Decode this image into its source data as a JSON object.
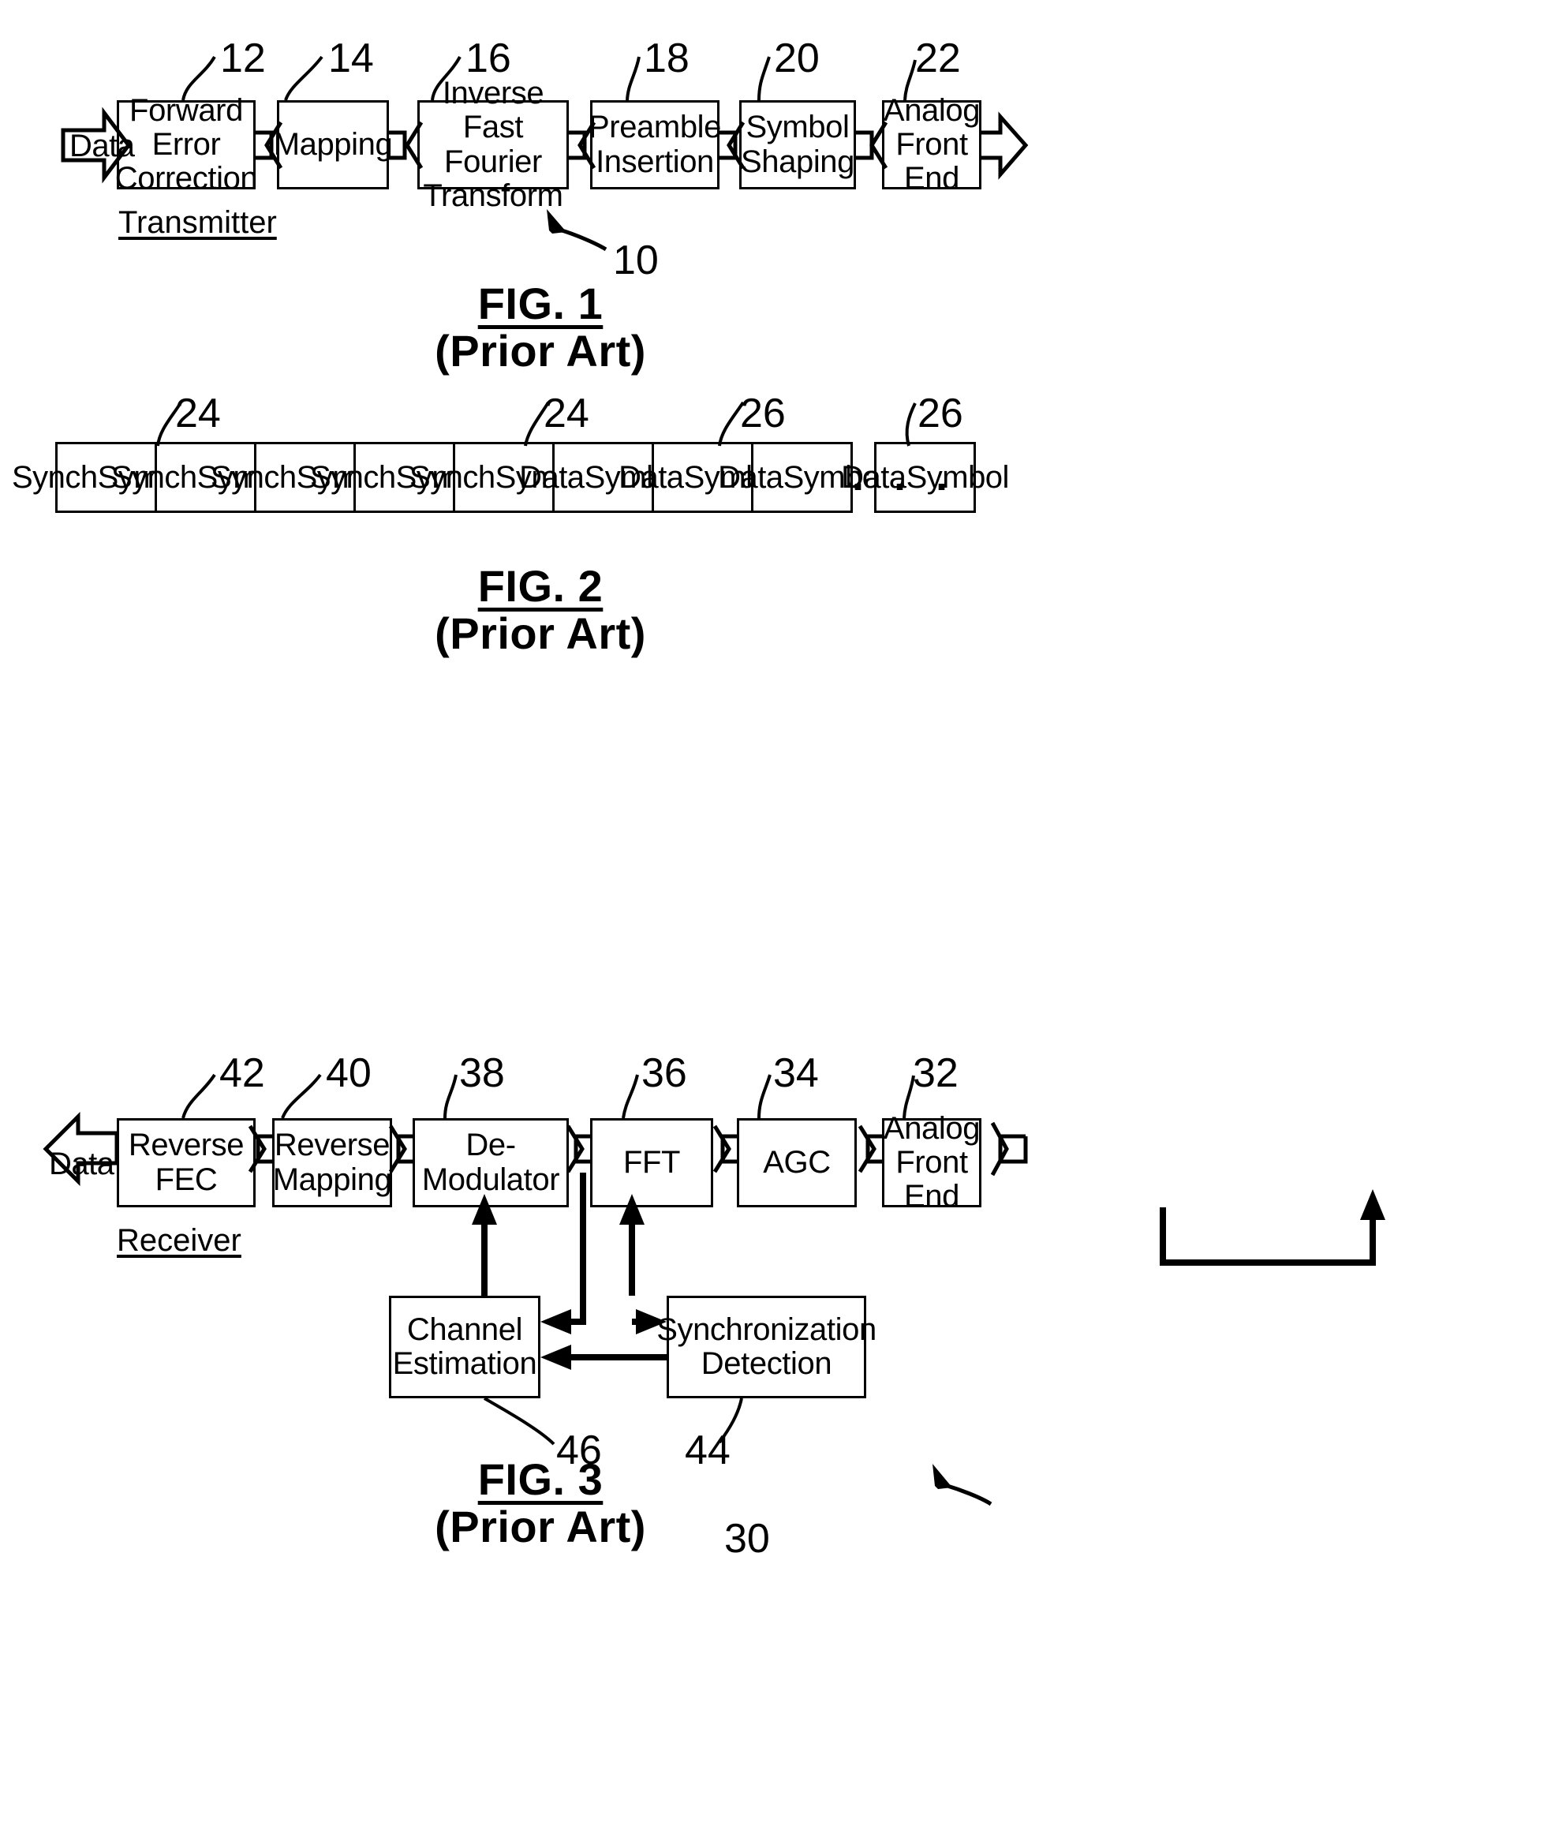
{
  "document": {
    "type": "patent-drawing-sheet",
    "figures": [
      {
        "id": "fig1",
        "caption": "FIG. 1",
        "subcaption": "(Prior Art)",
        "group_label": "Transmitter",
        "system_ref": "10",
        "io": {
          "input_label": "Data"
        },
        "blocks": [
          {
            "ref": "12",
            "lines": [
              "Forward",
              "Error",
              "Correction"
            ]
          },
          {
            "ref": "14",
            "lines": [
              "Mapping"
            ]
          },
          {
            "ref": "16",
            "lines": [
              "Inverse",
              "Fast Fourier",
              "Transform"
            ]
          },
          {
            "ref": "18",
            "lines": [
              "Preamble",
              "Insertion"
            ]
          },
          {
            "ref": "20",
            "lines": [
              "Symbol",
              "Shaping"
            ]
          },
          {
            "ref": "22",
            "lines": [
              "Analog",
              "Front",
              "End"
            ]
          }
        ]
      },
      {
        "id": "fig2",
        "caption": "FIG. 2",
        "subcaption": "(Prior Art)",
        "ellipsis": "· · ·",
        "callouts": [
          {
            "ref": "24"
          },
          {
            "ref": "24"
          },
          {
            "ref": "26"
          },
          {
            "ref": "26"
          }
        ],
        "cells": [
          {
            "lines": [
              "Synch",
              "Symbol"
            ]
          },
          {
            "lines": [
              "Synch",
              "Symbol"
            ]
          },
          {
            "lines": [
              "Synch",
              "Symbol"
            ]
          },
          {
            "lines": [
              "Synch",
              "Symbol"
            ]
          },
          {
            "lines": [
              "Synch",
              "Symbol"
            ]
          },
          {
            "lines": [
              "Data",
              "Symbol"
            ]
          },
          {
            "lines": [
              "Data",
              "Symbol"
            ]
          },
          {
            "lines": [
              "Data",
              "Symbol"
            ]
          },
          {
            "lines": [
              "Data",
              "Symbol"
            ]
          }
        ]
      },
      {
        "id": "fig3",
        "caption": "FIG. 3",
        "subcaption": "(Prior Art)",
        "group_label": "Receiver",
        "system_ref": "30",
        "io": {
          "output_label": "Data"
        },
        "blocks": [
          {
            "ref": "42",
            "lines": [
              "Reverse",
              "FEC"
            ]
          },
          {
            "ref": "40",
            "lines": [
              "Reverse",
              "Mapping"
            ]
          },
          {
            "ref": "38",
            "lines": [
              "De-",
              "Modulator"
            ]
          },
          {
            "ref": "36",
            "lines": [
              "FFT"
            ]
          },
          {
            "ref": "34",
            "lines": [
              "AGC"
            ]
          },
          {
            "ref": "32",
            "lines": [
              "Analog",
              "Front",
              "End"
            ]
          }
        ],
        "support_blocks": [
          {
            "ref": "46",
            "lines": [
              "Channel",
              "Estimation"
            ]
          },
          {
            "ref": "44",
            "lines": [
              "Synchronization",
              "Detection"
            ]
          }
        ]
      }
    ]
  },
  "colors": {
    "ink": "#000000",
    "paper": "#ffffff"
  }
}
